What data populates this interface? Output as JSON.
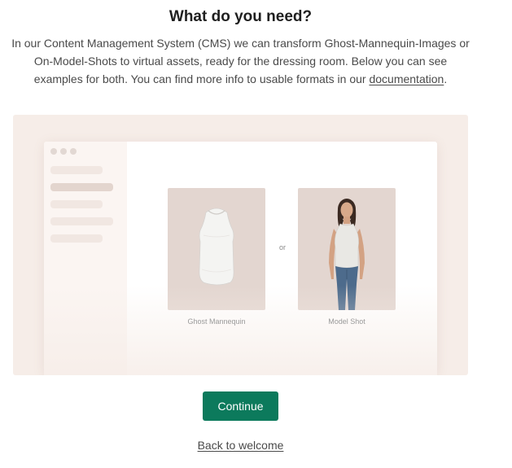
{
  "header": {
    "title": "What do you need?",
    "description": "In our Content Management System (CMS) we can transform Ghost-Mannequin-Images or On-Model-Shots to virtual assets, ready for the dressing room. Below you can see examples for both. You can find more info to usable formats in our ",
    "doc_link": "documentation",
    "description_end": "."
  },
  "examples": {
    "ghost_caption": "Ghost Mannequin",
    "separator": "or",
    "model_caption": "Model Shot"
  },
  "actions": {
    "continue_label": "Continue",
    "back_label": "Back to welcome"
  },
  "colors": {
    "primary": "#0c7a5c",
    "stage_background": "#f6ede8",
    "card_background": "#e3d6d0"
  }
}
